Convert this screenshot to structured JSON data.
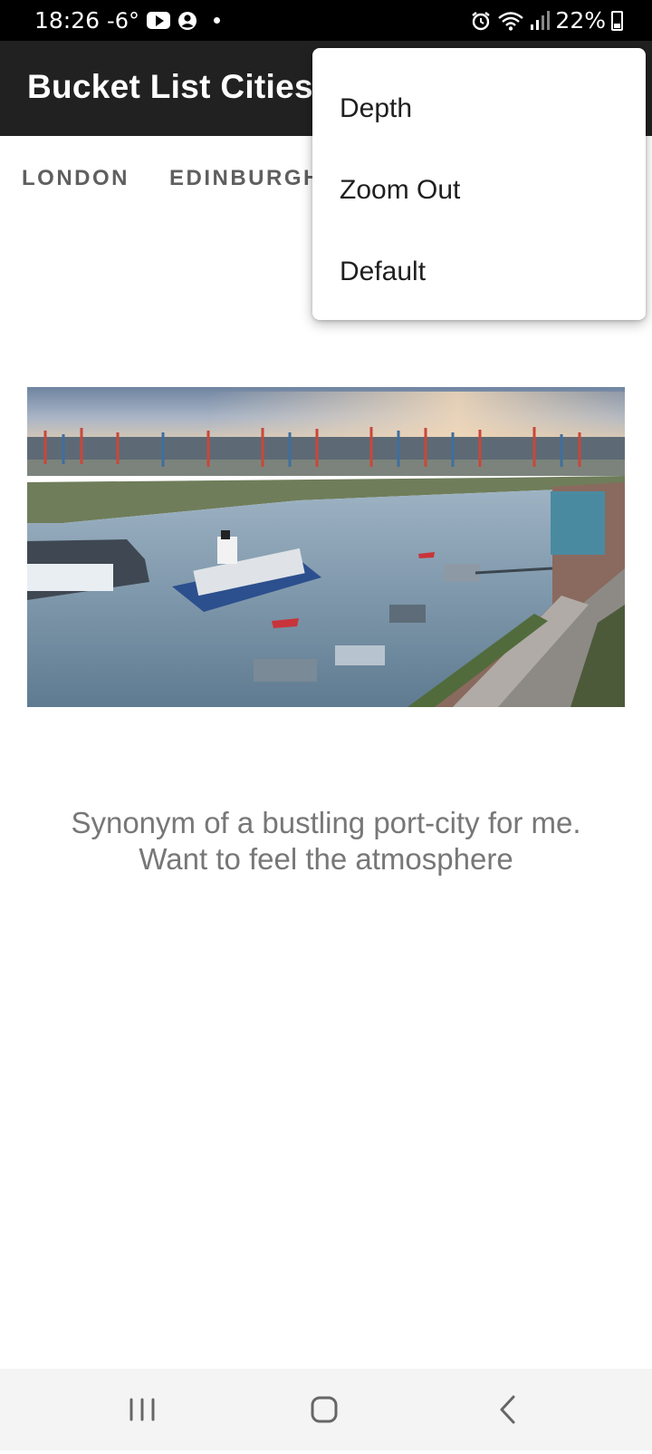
{
  "status_bar": {
    "time": "18:26",
    "temperature": "-6°",
    "battery": "22%",
    "icons": [
      "youtube-icon",
      "account-icon",
      "dot-icon",
      "alarm-icon",
      "wifi-icon",
      "signal-icon",
      "battery-icon"
    ]
  },
  "app_bar": {
    "title": "Bucket List Cities",
    "background": "#212121"
  },
  "tabs": [
    {
      "label": "LONDON"
    },
    {
      "label": "EDINBURGH"
    }
  ],
  "menu": {
    "items": [
      {
        "label": "Depth"
      },
      {
        "label": "Zoom Out"
      },
      {
        "label": "Default"
      }
    ]
  },
  "main": {
    "image_subject": "port-city harbour with container cranes and cargo ship",
    "caption_line1": "Synonym of a bustling port-city for me.",
    "caption_line2": "Want to feel the atmosphere"
  },
  "nav_bar": {
    "icons": [
      "recents-icon",
      "home-icon",
      "back-icon"
    ]
  }
}
